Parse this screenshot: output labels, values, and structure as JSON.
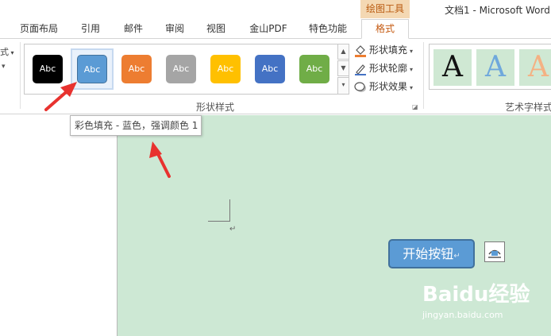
{
  "contextual_group": "绘图工具",
  "document_title": "文档1 - Microsoft Word",
  "tabs": [
    {
      "label": "页面布局"
    },
    {
      "label": "引用"
    },
    {
      "label": "邮件"
    },
    {
      "label": "审阅"
    },
    {
      "label": "视图"
    },
    {
      "label": "金山PDF"
    },
    {
      "label": "特色功能"
    },
    {
      "label": "格式",
      "active": true
    }
  ],
  "left_stub": "式",
  "shape_styles": {
    "swatches": [
      {
        "label": "Abc",
        "fill": "#000000",
        "text_color": "#ffffff"
      },
      {
        "label": "Abc",
        "fill": "#5b9bd5",
        "text_color": "#ffffff",
        "hovered": true
      },
      {
        "label": "Abc",
        "fill": "#ed7d31",
        "text_color": "#ffffff"
      },
      {
        "label": "Abc",
        "fill": "#a5a5a5",
        "text_color": "#ffffff"
      },
      {
        "label": "Abc",
        "fill": "#ffc000",
        "text_color": "#ffffff"
      },
      {
        "label": "Abc",
        "fill": "#4472c4",
        "text_color": "#ffffff"
      },
      {
        "label": "Abc",
        "fill": "#70ad47",
        "text_color": "#ffffff"
      }
    ],
    "commands": {
      "fill": "形状填充",
      "outline": "形状轮廓",
      "effects": "形状效果"
    },
    "group_label": "形状样式"
  },
  "wordart": {
    "group_label": "艺术字样式",
    "samples": [
      {
        "letter": "A",
        "color": "#111111"
      },
      {
        "letter": "A",
        "color": "#6fa8dc"
      },
      {
        "letter": "A",
        "color": "#f4b183"
      }
    ]
  },
  "tooltip": "彩色填充 - 蓝色，强调颜色 1",
  "document": {
    "shape_text": "开始按钮",
    "paragraph_mark": "↵"
  },
  "watermark": {
    "brand": "Baidu经验",
    "url": "jingyan.baidu.com"
  },
  "colors": {
    "accent_orange": "#c55a11",
    "annotation_red": "#e8322f",
    "page_green": "#cde8d4",
    "shape_blue": "#5b9bd5"
  }
}
